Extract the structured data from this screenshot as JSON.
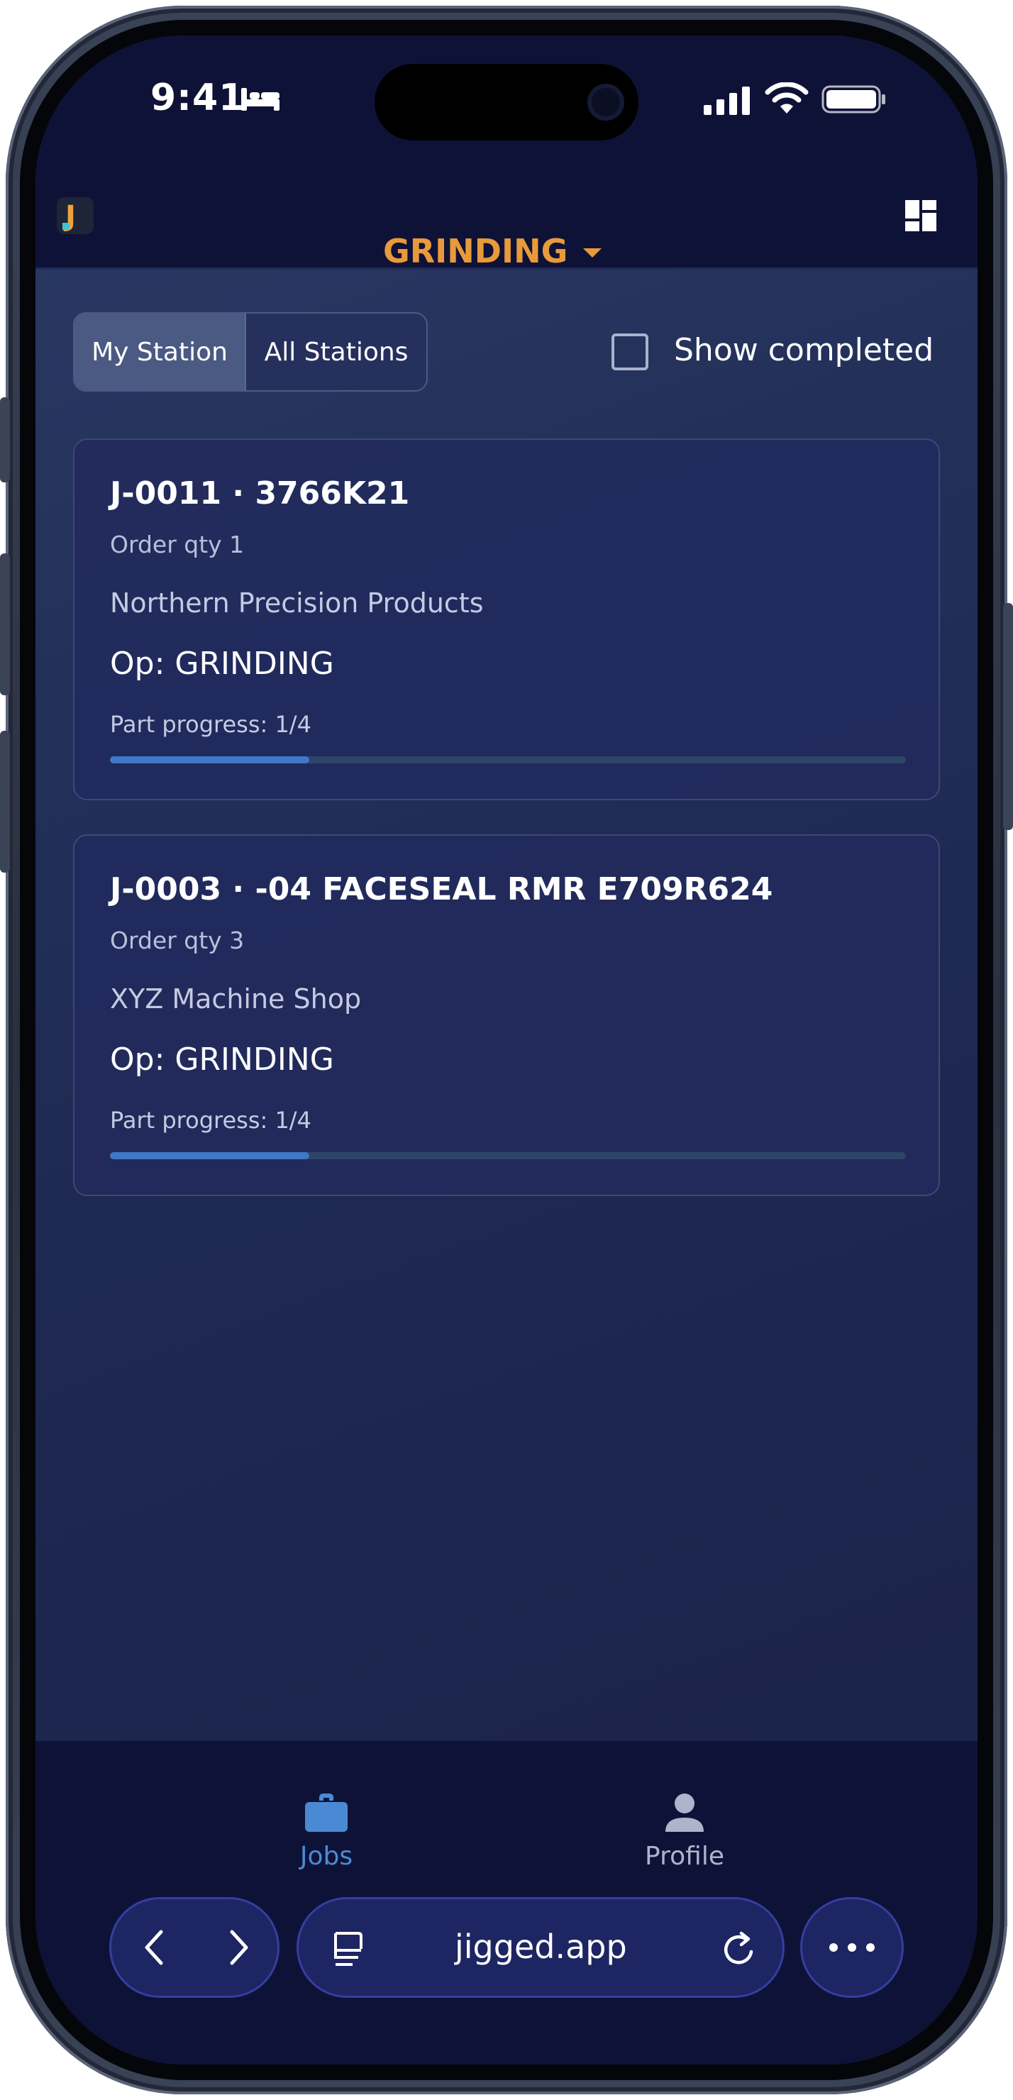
{
  "status_bar": {
    "time": "9:41"
  },
  "header": {
    "station_label": "GRINDING"
  },
  "filters": {
    "toggle_my_station": "My Station",
    "toggle_all_stations": "All Stations",
    "show_completed_label": "Show completed",
    "show_completed_checked": false
  },
  "jobs": [
    {
      "title": "J-0011 · 3766K21",
      "qty": "Order qty 1",
      "customer": "Northern Precision Products",
      "op": "Op: GRINDING",
      "progress_label": "Part progress: 1/4",
      "progress_fraction": 0.25
    },
    {
      "title": "J-0003 · -04 FACESEAL RMR E709R624",
      "qty": "Order qty 3",
      "customer": "XYZ Machine Shop",
      "op": "Op: GRINDING",
      "progress_label": "Part progress: 1/4",
      "progress_fraction": 0.25
    }
  ],
  "bottom_nav": {
    "jobs_label": "Jobs",
    "profile_label": "Profile",
    "active": "jobs"
  },
  "browser": {
    "url": "jigged.app"
  },
  "icons": [
    "bed-icon",
    "signal-icon",
    "wifi-icon",
    "battery-icon",
    "app-logo-icon",
    "caret-down-icon",
    "grid-icon",
    "briefcase-icon",
    "person-icon",
    "back-icon",
    "forward-icon",
    "reader-icon",
    "reload-icon",
    "more-icon"
  ],
  "colors": {
    "accent_orange": "#e89a3b",
    "nav_active": "#4a8ad4",
    "progress_fill": "#3f78c8",
    "header_bg": "#0f1237"
  }
}
